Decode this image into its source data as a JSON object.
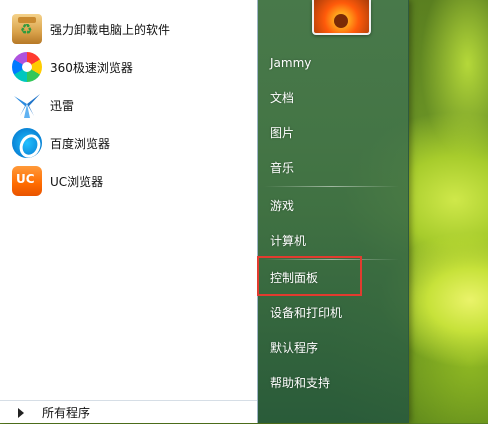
{
  "start_menu": {
    "pinned": [
      {
        "label": "强力卸载电脑上的软件",
        "icon": "uninstall-tool-icon"
      },
      {
        "label": "360极速浏览器",
        "icon": "360-browser-icon"
      },
      {
        "label": "迅雷",
        "icon": "xunlei-icon"
      },
      {
        "label": "百度浏览器",
        "icon": "baidu-browser-icon"
      },
      {
        "label": "UC浏览器",
        "icon": "uc-browser-icon"
      }
    ],
    "all_programs_label": "所有程序",
    "right_items": [
      {
        "label": "Jammy"
      },
      {
        "label": "文档"
      },
      {
        "label": "图片"
      },
      {
        "label": "音乐"
      },
      {
        "label": "游戏"
      },
      {
        "label": "计算机"
      },
      {
        "label": "控制面板"
      },
      {
        "label": "设备和打印机"
      },
      {
        "label": "默认程序"
      },
      {
        "label": "帮助和支持"
      }
    ]
  },
  "colors": {
    "highlight_border": "#e23b2f",
    "right_pane_bg": "#3f7a4f",
    "left_pane_bg": "#ffffff"
  }
}
